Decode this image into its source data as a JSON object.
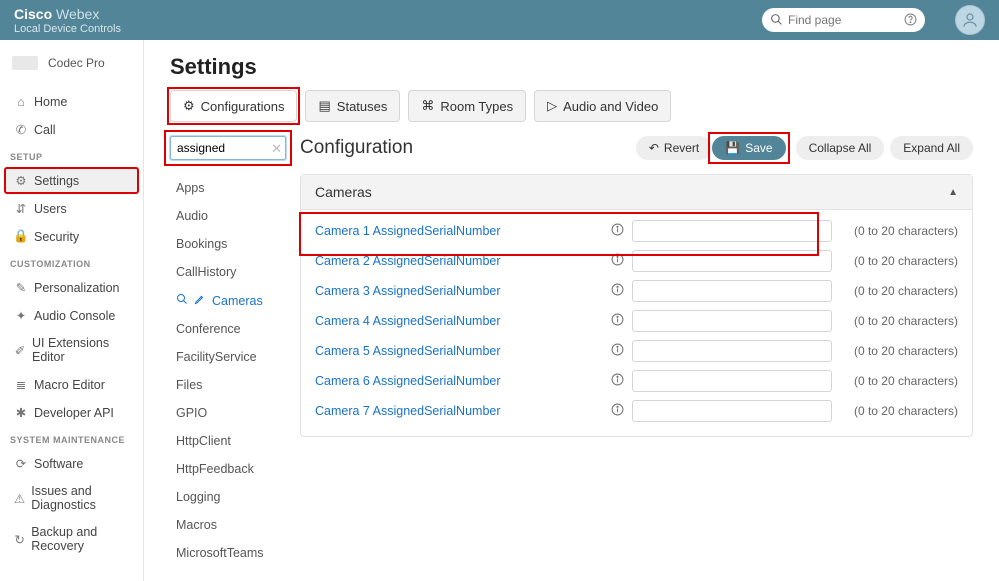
{
  "brand": {
    "name1": "Cisco",
    "name2": "Webex",
    "subtitle": "Local Device Controls"
  },
  "search": {
    "placeholder": "Find page"
  },
  "device": {
    "name": "Codec Pro"
  },
  "nav": {
    "top": [
      {
        "key": "home",
        "label": "Home",
        "icon": "⌂"
      },
      {
        "key": "call",
        "label": "Call",
        "icon": "✆"
      }
    ],
    "sections": [
      {
        "title": "SETUP",
        "items": [
          {
            "key": "settings",
            "label": "Settings",
            "icon": "⚙",
            "active": true
          },
          {
            "key": "users",
            "label": "Users",
            "icon": "⇵"
          },
          {
            "key": "security",
            "label": "Security",
            "icon": "🔒"
          }
        ]
      },
      {
        "title": "CUSTOMIZATION",
        "items": [
          {
            "key": "personalization",
            "label": "Personalization",
            "icon": "✎"
          },
          {
            "key": "audio-console",
            "label": "Audio Console",
            "icon": "✦"
          },
          {
            "key": "ui-ext",
            "label": "UI Extensions Editor",
            "icon": "✐"
          },
          {
            "key": "macro",
            "label": "Macro Editor",
            "icon": "≣"
          },
          {
            "key": "api",
            "label": "Developer API",
            "icon": "✱"
          }
        ]
      },
      {
        "title": "SYSTEM MAINTENANCE",
        "items": [
          {
            "key": "software",
            "label": "Software",
            "icon": "⟳"
          },
          {
            "key": "issues",
            "label": "Issues and Diagnostics",
            "icon": "⚠"
          },
          {
            "key": "backup",
            "label": "Backup and Recovery",
            "icon": "↻"
          }
        ]
      }
    ]
  },
  "page": {
    "title": "Settings",
    "tabs": [
      {
        "key": "configurations",
        "label": "Configurations",
        "icon": "⚙",
        "active": true
      },
      {
        "key": "statuses",
        "label": "Statuses",
        "icon": "▤"
      },
      {
        "key": "room-types",
        "label": "Room Types",
        "icon": "⌘"
      },
      {
        "key": "audio-video",
        "label": "Audio and Video",
        "icon": "▷"
      }
    ],
    "filter": {
      "value": "assigned"
    },
    "filter_categories": [
      "Apps",
      "Audio",
      "Bookings",
      "CallHistory",
      "Cameras",
      "Conference",
      "FacilityService",
      "Files",
      "GPIO",
      "HttpClient",
      "HttpFeedback",
      "Logging",
      "Macros",
      "MicrosoftTeams"
    ],
    "filter_active": "Cameras",
    "config": {
      "title": "Configuration",
      "buttons": {
        "revert": "Revert",
        "save": "Save",
        "collapse": "Collapse All",
        "expand": "Expand All"
      },
      "section": {
        "title": "Cameras"
      },
      "rows": [
        {
          "label": "Camera 1 AssignedSerialNumber",
          "value": "",
          "hint": "(0 to 20 characters)"
        },
        {
          "label": "Camera 2 AssignedSerialNumber",
          "value": "",
          "hint": "(0 to 20 characters)"
        },
        {
          "label": "Camera 3 AssignedSerialNumber",
          "value": "",
          "hint": "(0 to 20 characters)"
        },
        {
          "label": "Camera 4 AssignedSerialNumber",
          "value": "",
          "hint": "(0 to 20 characters)"
        },
        {
          "label": "Camera 5 AssignedSerialNumber",
          "value": "",
          "hint": "(0 to 20 characters)"
        },
        {
          "label": "Camera 6 AssignedSerialNumber",
          "value": "",
          "hint": "(0 to 20 characters)"
        },
        {
          "label": "Camera 7 AssignedSerialNumber",
          "value": "",
          "hint": "(0 to 20 characters)"
        }
      ]
    }
  }
}
